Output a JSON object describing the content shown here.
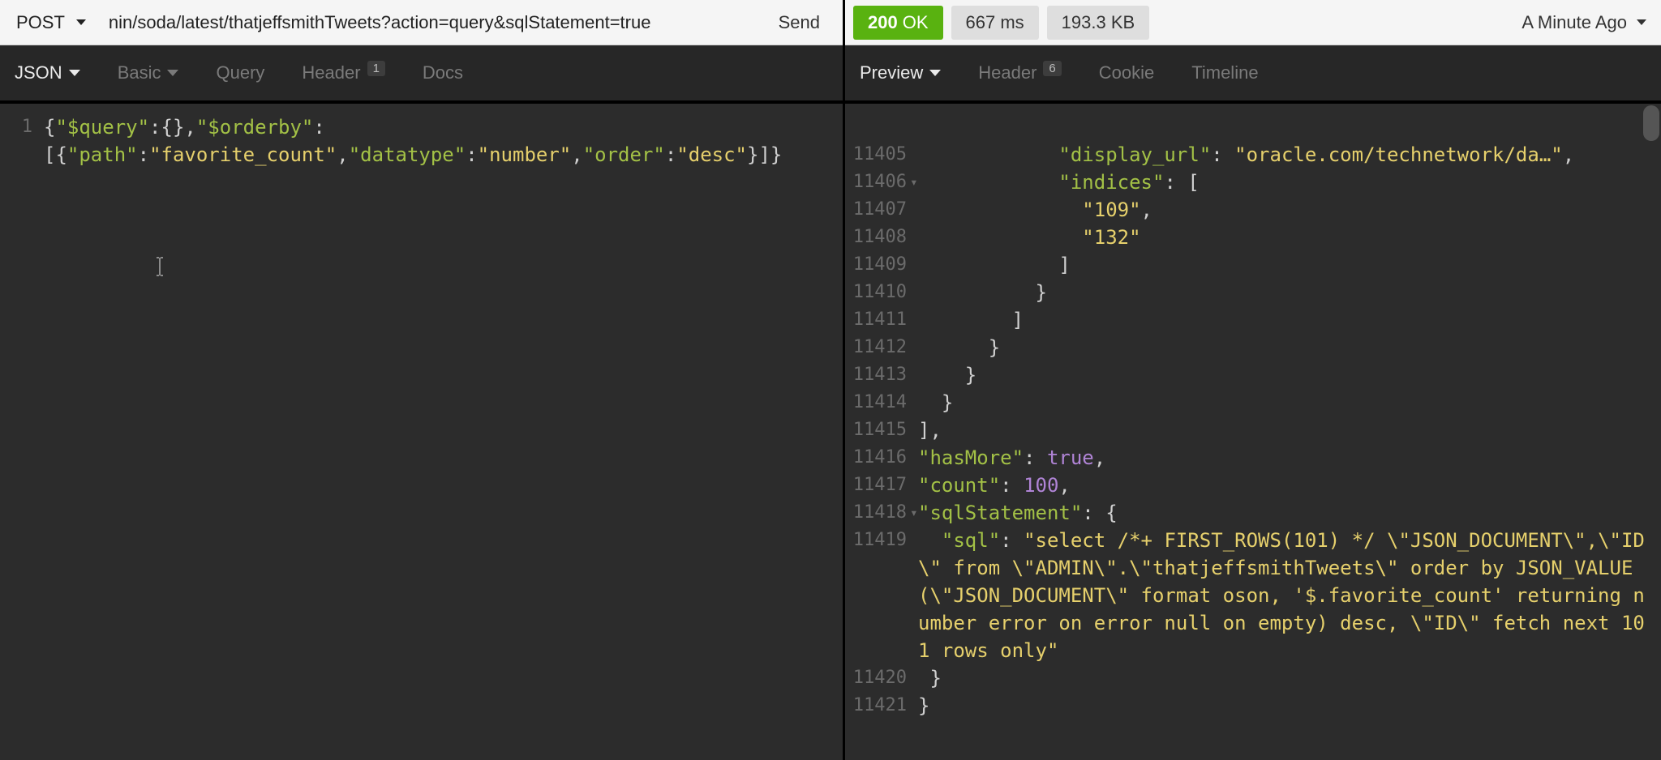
{
  "request": {
    "method": "POST",
    "url": "nin/soda/latest/thatjeffsmithTweets?action=query&sqlStatement=true",
    "send_label": "Send"
  },
  "response_status": {
    "code": "200",
    "text": "OK",
    "time": "667 ms",
    "size": "193.3 KB",
    "timestamp": "A Minute Ago"
  },
  "left_tabs": {
    "json": "JSON",
    "basic": "Basic",
    "query": "Query",
    "header": "Header",
    "header_badge": "1",
    "docs": "Docs"
  },
  "right_tabs": {
    "preview": "Preview",
    "header": "Header",
    "header_badge": "6",
    "cookie": "Cookie",
    "timeline": "Timeline"
  },
  "request_body": {
    "line_no": "1",
    "k_query": "\"$query\"",
    "k_orderby": "\"$orderby\"",
    "k_path": "\"path\"",
    "v_path": "\"favorite_count\"",
    "k_datatype": "\"datatype\"",
    "v_datatype": "\"number\"",
    "k_order": "\"order\"",
    "v_order": "\"desc\""
  },
  "response_body": {
    "top_link_fragment": "",
    "lines": {
      "l11405": {
        "no": "11405",
        "key": "\"display_url\"",
        "val": "\"oracle.com/technetwork/da…\""
      },
      "l11406": {
        "no": "11406",
        "key": "\"indices\""
      },
      "l11407": {
        "no": "11407",
        "val": "\"109\""
      },
      "l11408": {
        "no": "11408",
        "val": "\"132\""
      },
      "l11409": {
        "no": "11409"
      },
      "l11410": {
        "no": "11410"
      },
      "l11411": {
        "no": "11411"
      },
      "l11412": {
        "no": "11412"
      },
      "l11413": {
        "no": "11413"
      },
      "l11414": {
        "no": "11414"
      },
      "l11415": {
        "no": "11415"
      },
      "l11416": {
        "no": "11416",
        "key": "\"hasMore\"",
        "val": "true"
      },
      "l11417": {
        "no": "11417",
        "key": "\"count\"",
        "val": "100"
      },
      "l11418": {
        "no": "11418",
        "key": "\"sqlStatement\""
      },
      "l11419": {
        "no": "11419",
        "key": "\"sql\"",
        "val": "\"select /*+ FIRST_ROWS(101) */ \\\"JSON_DOCUMENT\\\",\\\"ID\\\" from \\\"ADMIN\\\".\\\"thatjeffsmithTweets\\\" order by JSON_VALUE(\\\"JSON_DOCUMENT\\\" format oson, '$.favorite_count' returning number error on error null on empty) desc, \\\"ID\\\" fetch next 101 rows only\""
      },
      "l11420": {
        "no": "11420"
      },
      "l11421": {
        "no": "11421"
      }
    }
  }
}
